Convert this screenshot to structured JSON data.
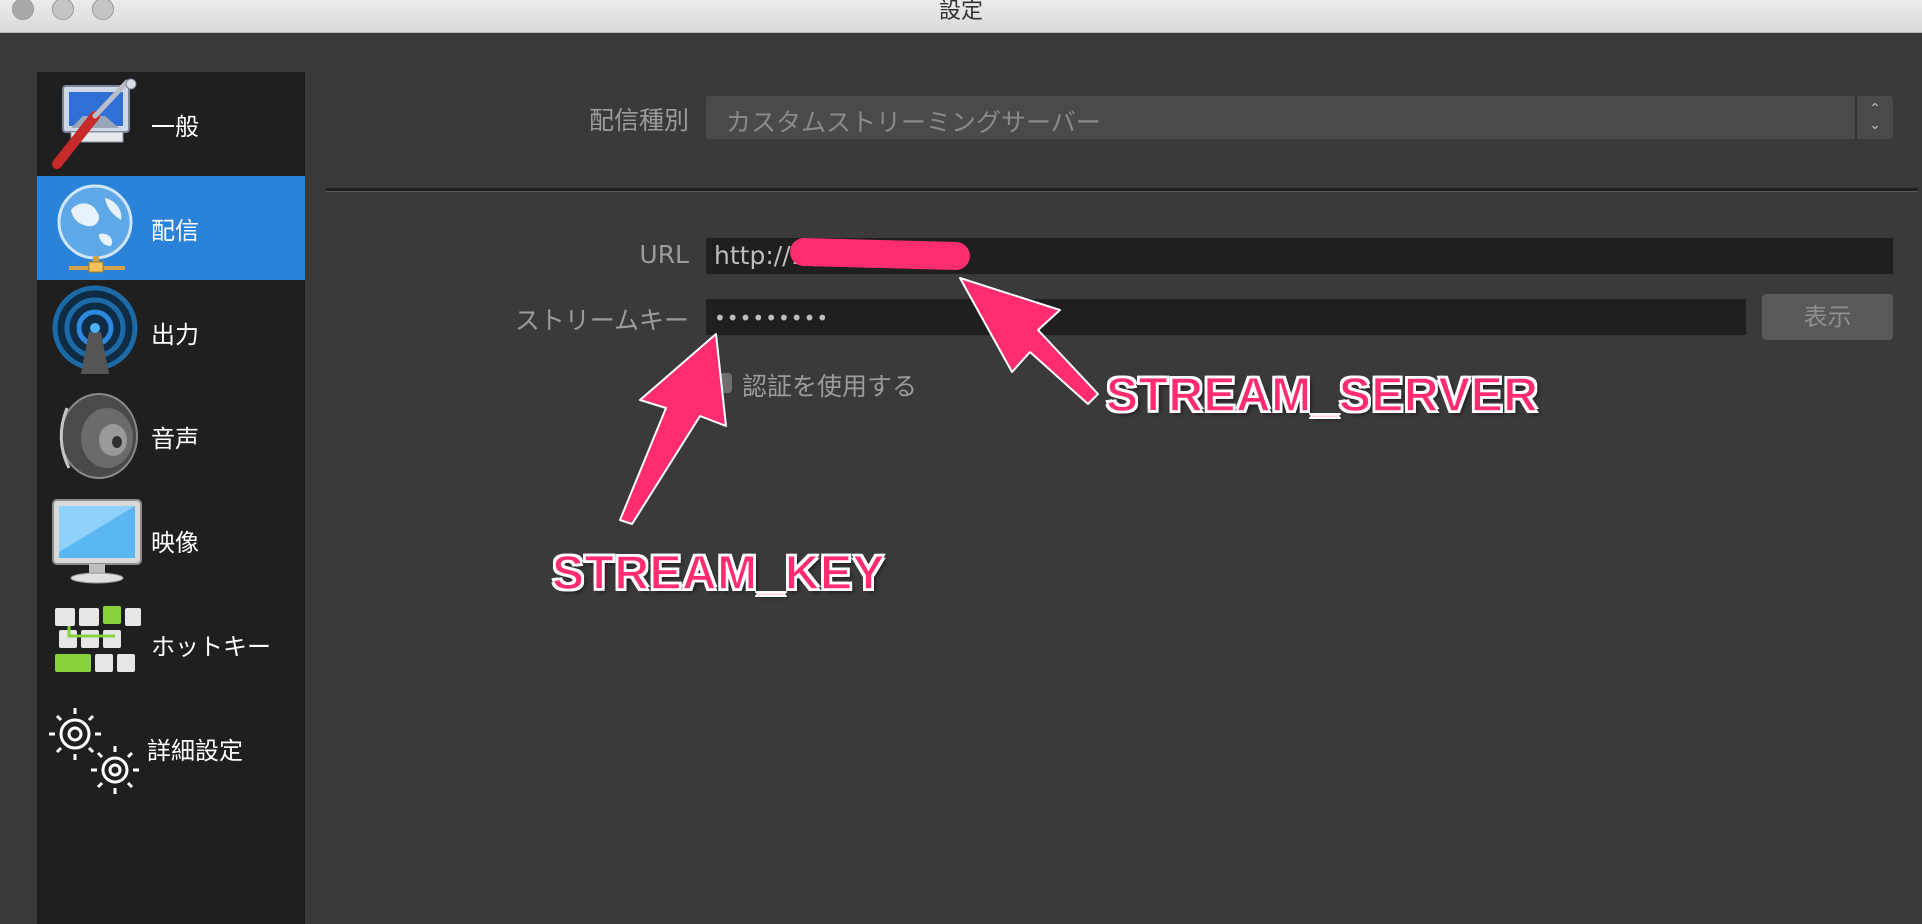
{
  "window": {
    "title": "設定"
  },
  "sidebar": {
    "items": [
      {
        "label": "一般",
        "icon": "general-settings-icon"
      },
      {
        "label": "配信",
        "icon": "globe-network-icon",
        "active": true
      },
      {
        "label": "出力",
        "icon": "broadcast-antenna-icon"
      },
      {
        "label": "音声",
        "icon": "speaker-icon"
      },
      {
        "label": "映像",
        "icon": "monitor-icon"
      },
      {
        "label": "ホットキー",
        "icon": "keyboard-icon"
      },
      {
        "label": "詳細設定",
        "icon": "gears-icon"
      }
    ]
  },
  "stream": {
    "service_label": "配信種別",
    "service_value": "カスタムストリーミングサーバー",
    "url_label": "URL",
    "url_value": "http://1        /live",
    "key_label": "ストリームキー",
    "key_value": "•••••••••",
    "show_button": "表示",
    "auth_checkbox_label": "認証を使用する",
    "auth_checked": false
  },
  "annotations": {
    "server": "STREAM_SERVER",
    "key": "STREAM_KEY"
  },
  "colors": {
    "accent": "#2b82d9",
    "annotation": "#ff2d6f",
    "background": "#3a3a3a",
    "sidebar": "#1f1f1f"
  }
}
